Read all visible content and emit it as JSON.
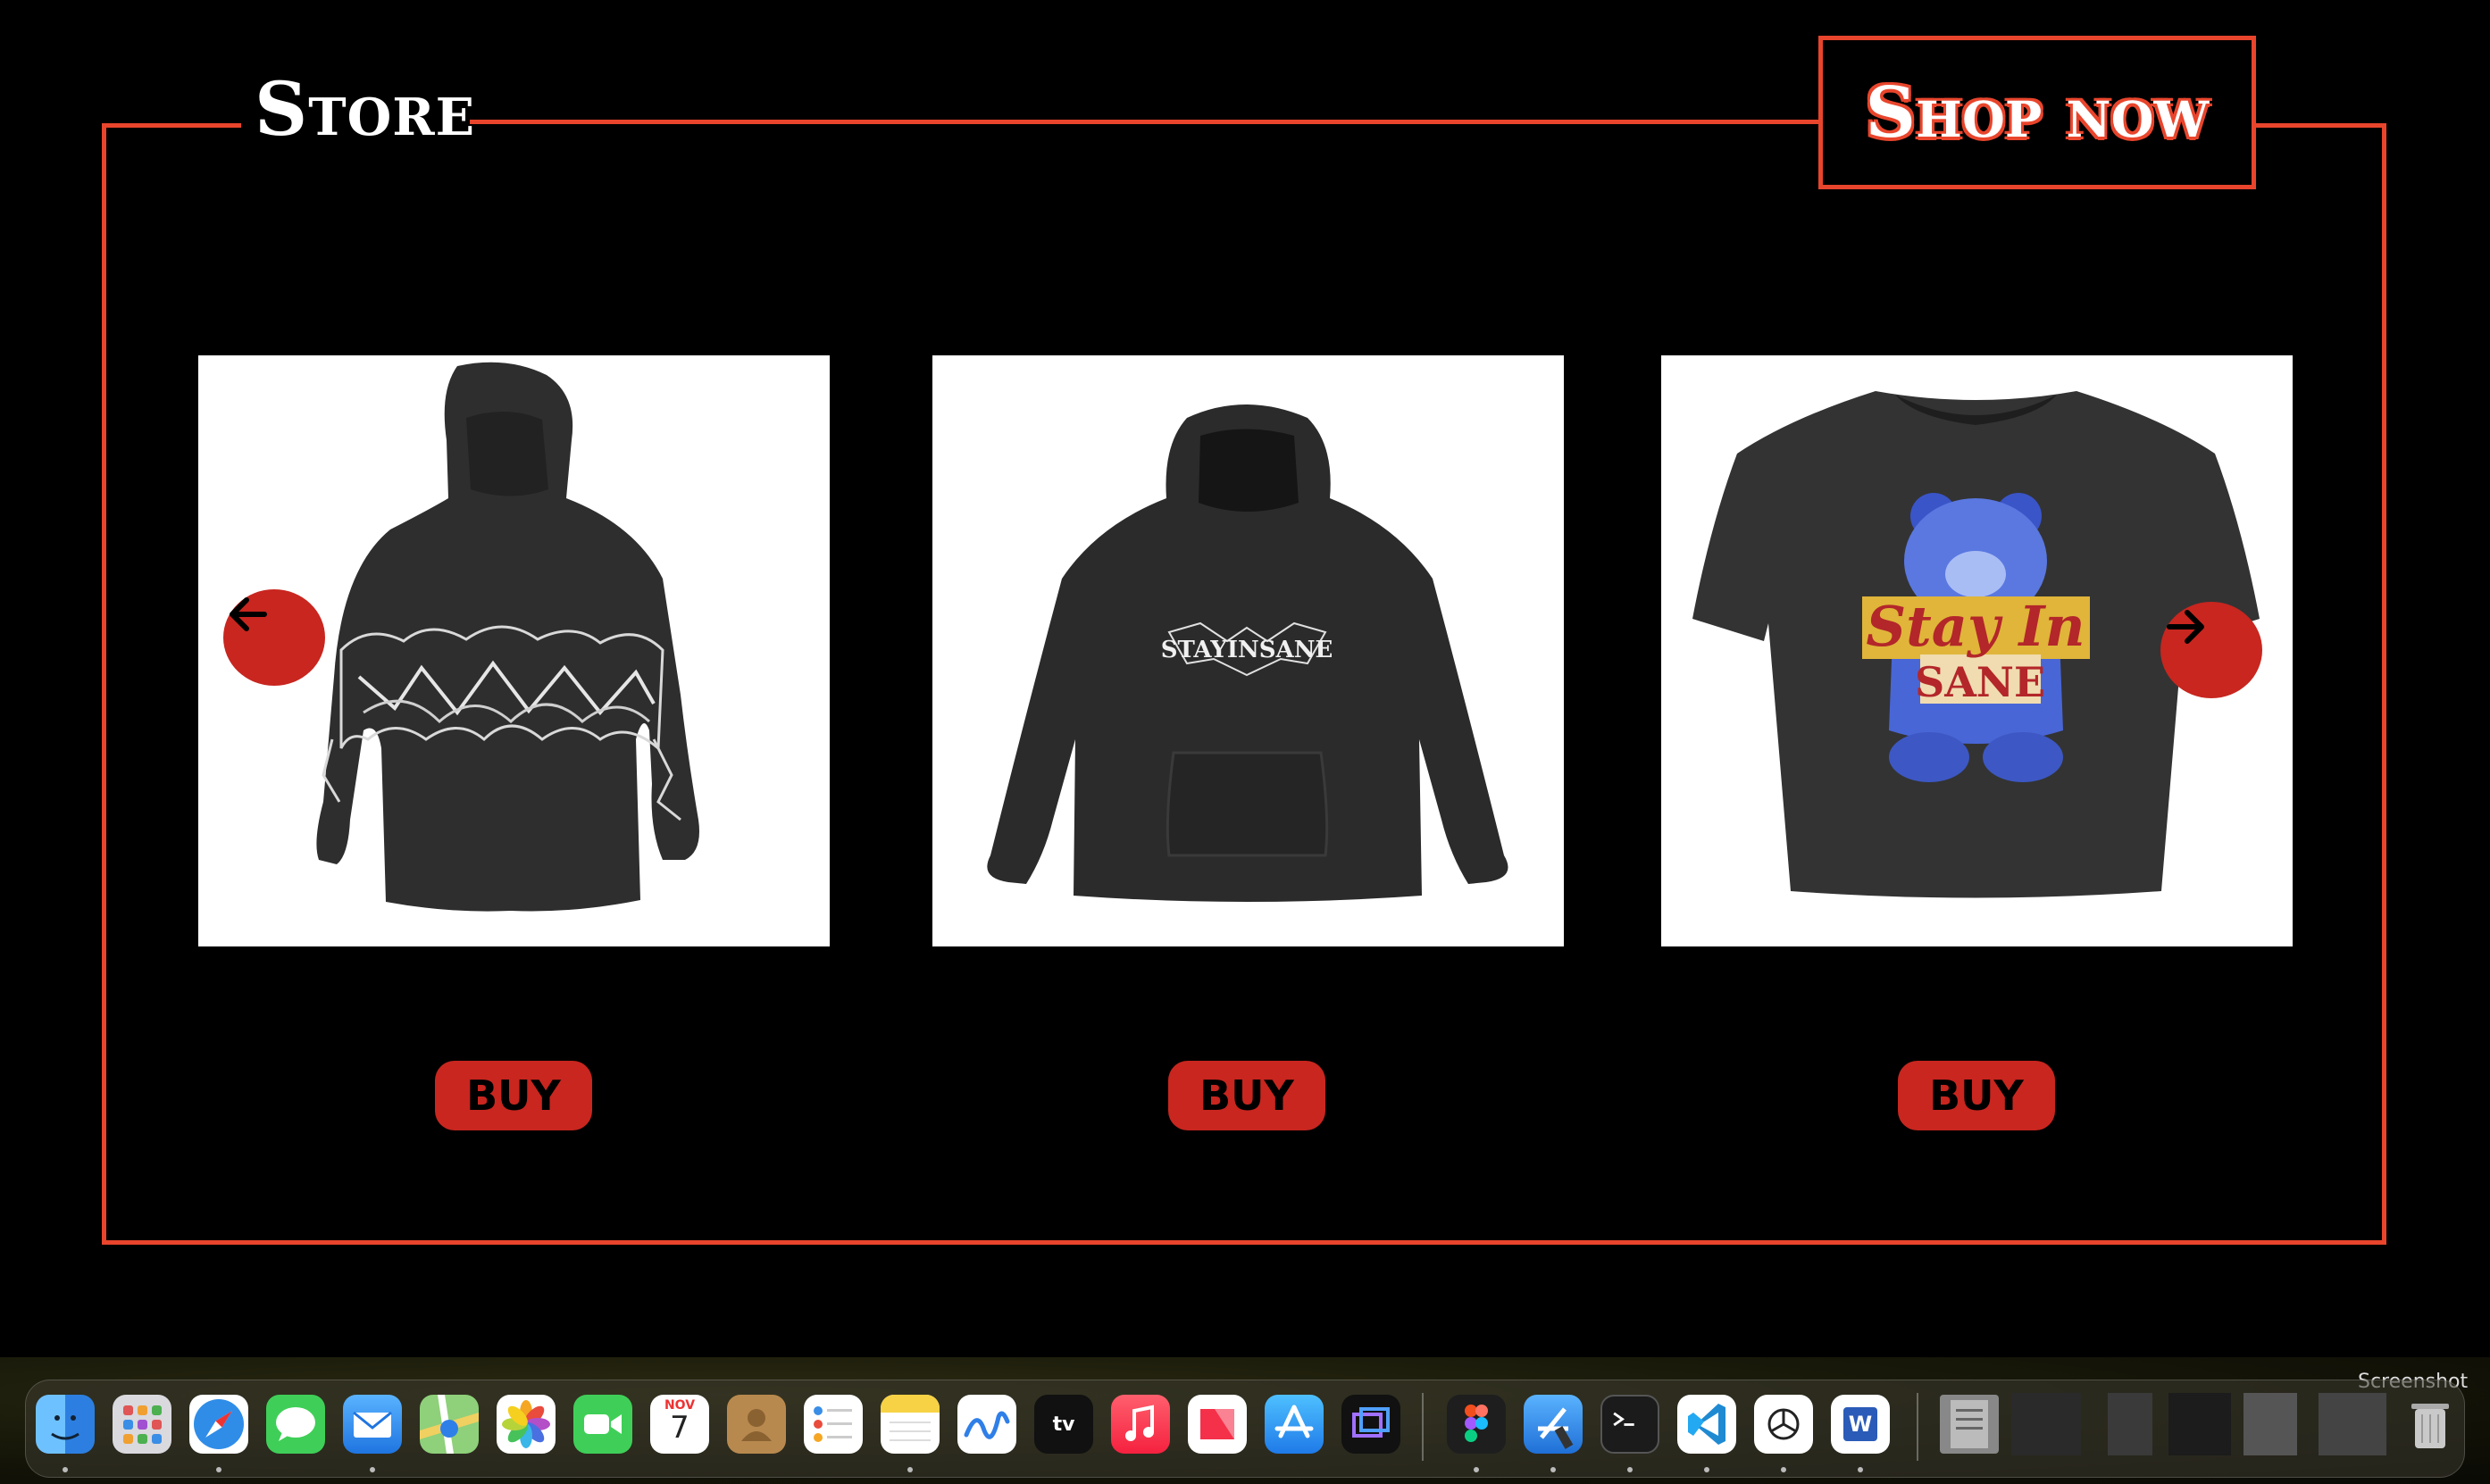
{
  "store": {
    "title": "Store"
  },
  "shop_button": {
    "label": "Shop now"
  },
  "products": [
    {
      "name": "hoodie-graphic",
      "buy_label": "BUY"
    },
    {
      "name": "hoodie-stayinsane",
      "buy_label": "BUY",
      "print_text": "STAYINSANE"
    },
    {
      "name": "tee-bear",
      "buy_label": "BUY",
      "print_text_1": "Stay In",
      "print_text_2": "SANE"
    }
  ],
  "carousel": {
    "prev_icon": "arrow-left-icon",
    "next_icon": "arrow-right-icon"
  },
  "colors": {
    "accent": "#e8452c",
    "button": "#c8261f",
    "background": "#000000"
  },
  "dock": {
    "calendar_month": "NOV",
    "calendar_day": "7",
    "tv_label": "tv",
    "word_label": "W",
    "corner_text": "Screenshot"
  }
}
